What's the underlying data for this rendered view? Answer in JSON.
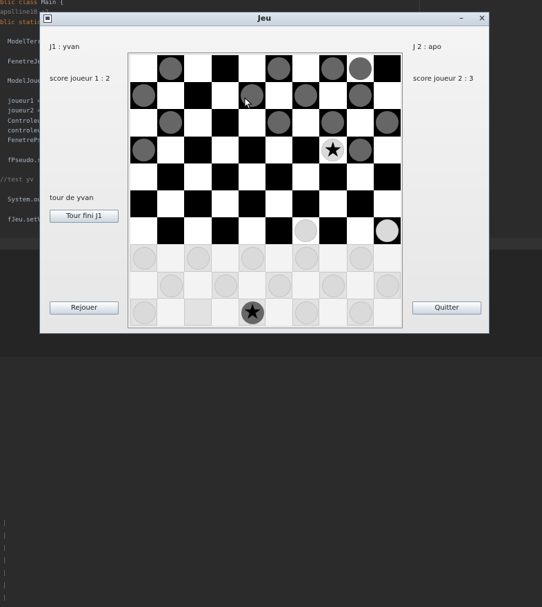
{
  "ide": {
    "code_lines": [
      {
        "kw": "blic class ",
        "txt": "Main {"
      },
      {
        "anno": "apolline18 +2"
      },
      {
        "kw": "blic static",
        "txt": ""
      },
      {
        "txt": ""
      },
      {
        "txt": "ModelTerr"
      },
      {
        "txt": ""
      },
      {
        "txt": "FenetreJe"
      },
      {
        "txt": ""
      },
      {
        "txt": "ModelJoue"
      },
      {
        "txt": ""
      },
      {
        "txt": "joueur1 ="
      },
      {
        "txt": "joueur2 ="
      },
      {
        "txt": "Controleu"
      },
      {
        "txt": "controleu"
      },
      {
        "txt": "FenetrePs"
      },
      {
        "txt": ""
      },
      {
        "txt": "fPseudo.s"
      },
      {
        "txt": ""
      },
      {
        "anno": "//test yv"
      },
      {
        "txt": ""
      },
      {
        "txt": "System.ou"
      },
      {
        "txt": ""
      },
      {
        "txt": "fJeu.setV"
      }
    ]
  },
  "window": {
    "title": "Jeu",
    "minimize_label": "–",
    "close_label": "×"
  },
  "left_panel": {
    "player1_label": "J1 : yvan",
    "score1_label": "score joueur 1 : 2",
    "turn_label": "tour de yvan",
    "end_turn_button": "Tour fini J1",
    "replay_button": "Rejouer"
  },
  "right_panel": {
    "player2_label": "J 2 : apo",
    "score2_label": "score joueur 2 : 3",
    "quit_button": "Quitter"
  },
  "board": {
    "size": 10,
    "rows": [
      "-g-.-g-gg",
      "g...g.g.g.",
      ".g...g.g.g",
      "g......Kg.",
      "..........",
      "..........",
      "......w..w",
      "w.w.w.w.w.",
      ".w.w.w.w.w",
      "w...K.w.w."
    ],
    "legend": {
      "g": "dark-grey piece (player 2)",
      "w": "light-grey piece (player 1)",
      "K": "king (queen) piece with star"
    },
    "king_symbol": "★",
    "colors": {
      "light_square": "#ffffff",
      "dark_square": "#000000",
      "p2_piece": "#666666",
      "p1_piece": "#dadada"
    }
  }
}
